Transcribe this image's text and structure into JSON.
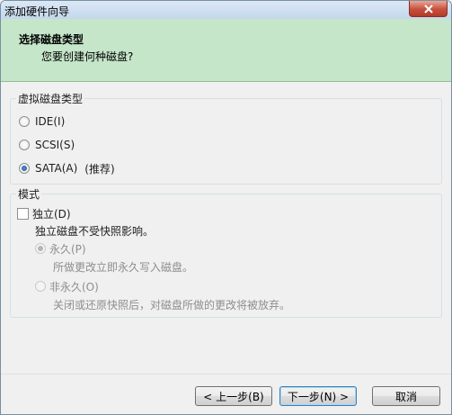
{
  "window": {
    "title": "添加硬件向导"
  },
  "header": {
    "title": "选择磁盘类型",
    "subtitle": "您要创建何种磁盘?"
  },
  "disk_type": {
    "legend": "虚拟磁盘类型",
    "options": [
      {
        "label": "IDE(I)",
        "checked": false
      },
      {
        "label": "SCSI(S)",
        "checked": false
      },
      {
        "label": "SATA(A)",
        "checked": true,
        "note": "(推荐)"
      }
    ]
  },
  "mode": {
    "legend": "模式",
    "independent_label": "独立(D)",
    "independent_checked": false,
    "description": "独立磁盘不受快照影响。",
    "persistent_label": "永久(P)",
    "persistent_desc": "所做更改立即永久写入磁盘。",
    "nonpersistent_label": "非永久(O)",
    "nonpersistent_desc": "关闭或还原快照后，对磁盘所做的更改将被放弃。"
  },
  "buttons": {
    "back": "< 上一步(B)",
    "next": "下一步(N) >",
    "cancel": "取消"
  }
}
